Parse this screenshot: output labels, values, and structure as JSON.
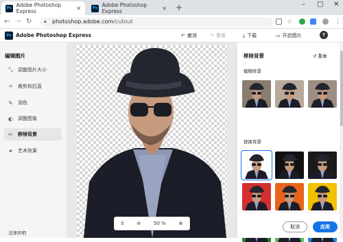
{
  "browser": {
    "tabs": [
      {
        "title": "Adobe Photoshop Express",
        "active": true
      },
      {
        "title": "Adobe Photoshop Express",
        "active": false
      }
    ],
    "url_host": "photoshop.adobe.com",
    "url_path": "/cutout"
  },
  "app": {
    "logo_text": "Ps",
    "title": "Adobe Photoshop Express",
    "toolbar": {
      "undo": "撤消",
      "redo": "重做",
      "download": "下载",
      "open": "开启图片"
    }
  },
  "sidebar": {
    "heading": "编辑图片",
    "items": [
      {
        "label": "调整图片大小",
        "icon": "resize-icon"
      },
      {
        "label": "裁剪和拉直",
        "icon": "crop-icon"
      },
      {
        "label": "润色",
        "icon": "brush-icon"
      },
      {
        "label": "调整图像",
        "icon": "adjust-icon"
      },
      {
        "label": "移除背景",
        "icon": "scissors-icon",
        "selected": true
      },
      {
        "label": "艺术效果",
        "icon": "effects-icon"
      }
    ],
    "legal": "法律声明"
  },
  "canvas": {
    "zoom": "50 %"
  },
  "panel": {
    "title": "移除背景",
    "reset": "重做",
    "blur_label": "模糊背景",
    "replace_label": "替换背景",
    "cancel": "取消",
    "apply": "应用"
  },
  "colors": {
    "accent": "#1473e6",
    "brand": "#001e36"
  }
}
